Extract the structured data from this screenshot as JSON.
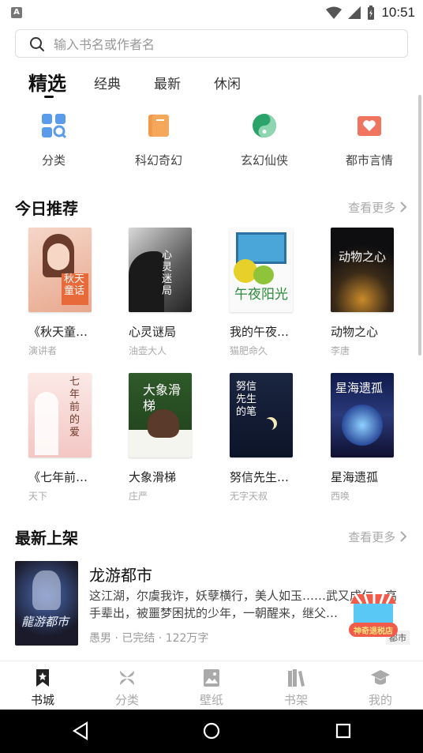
{
  "status_bar": {
    "time": "10:51",
    "notif": "A"
  },
  "search": {
    "placeholder": "输入书名或作者名"
  },
  "tabs": [
    {
      "label": "精选",
      "active": true
    },
    {
      "label": "经典"
    },
    {
      "label": "最新"
    },
    {
      "label": "休闲"
    }
  ],
  "categories": [
    {
      "label": "分类",
      "icon": "grid-search-icon",
      "color": "#4a90e2"
    },
    {
      "label": "科幻奇幻",
      "icon": "book-icon",
      "color": "#f0883a"
    },
    {
      "label": "玄幻仙侠",
      "icon": "taiji-icon",
      "color": "#2ba36a"
    },
    {
      "label": "都市言情",
      "icon": "heart-book-icon",
      "color": "#f06a5a"
    }
  ],
  "today": {
    "title": "今日推荐",
    "more": "查看更多",
    "books": [
      {
        "title": "《秋天童…",
        "author": "演讲者",
        "cover_text": "秋天童话"
      },
      {
        "title": "心灵谜局",
        "author": "油壶大人",
        "cover_text": "心灵迷局"
      },
      {
        "title": "我的午夜…",
        "author": "猫肥命久",
        "cover_text": "午夜阳光"
      },
      {
        "title": "动物之心",
        "author": "李唐",
        "cover_text": "动物之心"
      },
      {
        "title": "《七年前…",
        "author": "天下",
        "cover_text": "七年前的爱"
      },
      {
        "title": "大象滑梯",
        "author": "庄严",
        "cover_text": "大象滑梯"
      },
      {
        "title": "努信先生…",
        "author": "无字天叔",
        "cover_text": "努信先生的笔"
      },
      {
        "title": "星海遗孤",
        "author": "西唤",
        "cover_text": "星海遗孤"
      }
    ]
  },
  "new_arrivals": {
    "title": "最新上架",
    "more": "查看更多",
    "book": {
      "title": "龙游都市",
      "desc": "这江湖，尔虞我诈，妖孽横行，美人如玉……武又成仁，高手辈出，被噩梦困扰的少年，一朝醒来，继父…",
      "meta": "愚男 · 已完结 · 122万字",
      "tag": "都市",
      "cover_text": "龍游都市"
    }
  },
  "promo": {
    "label": "神奇退税店"
  },
  "bottom_nav": [
    {
      "label": "书城",
      "icon": "bookmark-icon",
      "active": true
    },
    {
      "label": "分类",
      "icon": "category-icon"
    },
    {
      "label": "壁纸",
      "icon": "image-icon"
    },
    {
      "label": "书架",
      "icon": "bookshelf-icon"
    },
    {
      "label": "我的",
      "icon": "graduation-cap-icon"
    }
  ]
}
